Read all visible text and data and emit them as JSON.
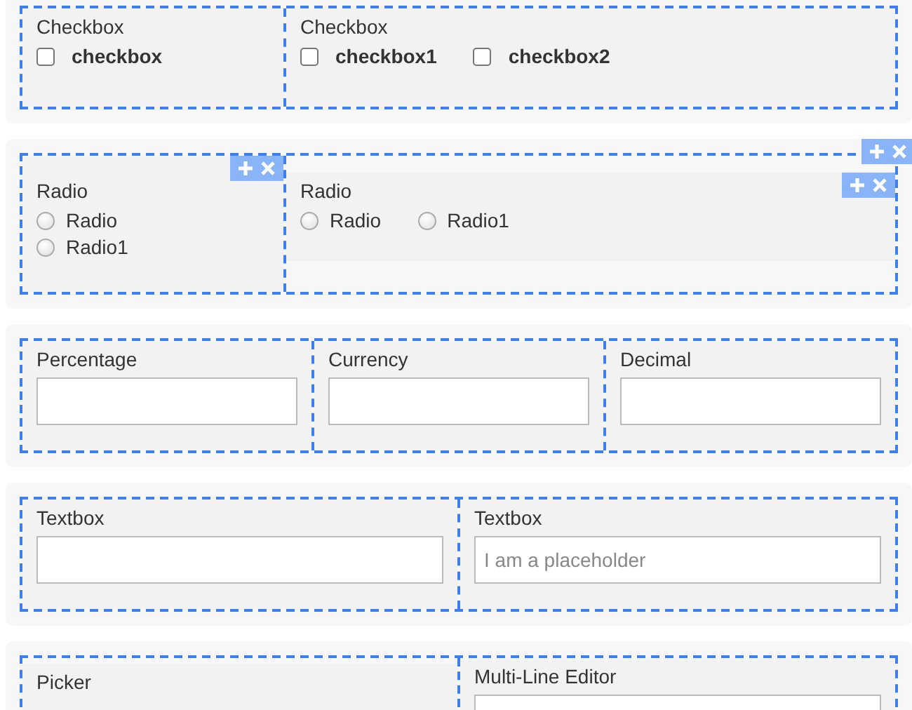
{
  "sections": [
    {
      "toolbar": false,
      "columns": [
        {
          "kind": "checkboxes",
          "label": "Checkbox",
          "toolbar": false,
          "options": [
            {
              "label": "checkbox",
              "checked": false
            }
          ]
        },
        {
          "kind": "checkboxes",
          "label": "Checkbox",
          "toolbar": false,
          "options": [
            {
              "label": "checkbox1",
              "checked": false
            },
            {
              "label": "checkbox2",
              "checked": false
            }
          ]
        }
      ]
    },
    {
      "toolbar": true,
      "columns": [
        {
          "kind": "radios",
          "label": "Radio",
          "toolbar": true,
          "options": [
            {
              "label": "Radio",
              "selected": false
            },
            {
              "label": "Radio1",
              "selected": false
            }
          ]
        },
        {
          "kind": "radios",
          "label": "Radio",
          "toolbar": true,
          "options": [
            {
              "label": "Radio",
              "selected": false
            },
            {
              "label": "Radio1",
              "selected": false
            }
          ]
        }
      ]
    },
    {
      "toolbar": false,
      "columns": [
        {
          "kind": "input",
          "label": "Percentage",
          "toolbar": false
        },
        {
          "kind": "input",
          "label": "Currency",
          "toolbar": false
        },
        {
          "kind": "input",
          "label": "Decimal",
          "toolbar": false
        }
      ]
    },
    {
      "toolbar": false,
      "columns": [
        {
          "kind": "input",
          "label": "Textbox",
          "toolbar": false
        },
        {
          "kind": "input",
          "label": "Textbox",
          "toolbar": false,
          "placeholder": "I am a placeholder"
        }
      ]
    },
    {
      "toolbar": false,
      "columns": [
        {
          "kind": "picker",
          "label": "Picker",
          "toolbar": false
        },
        {
          "kind": "textarea",
          "label": "Multi-Line Editor",
          "toolbar": false
        }
      ]
    }
  ]
}
